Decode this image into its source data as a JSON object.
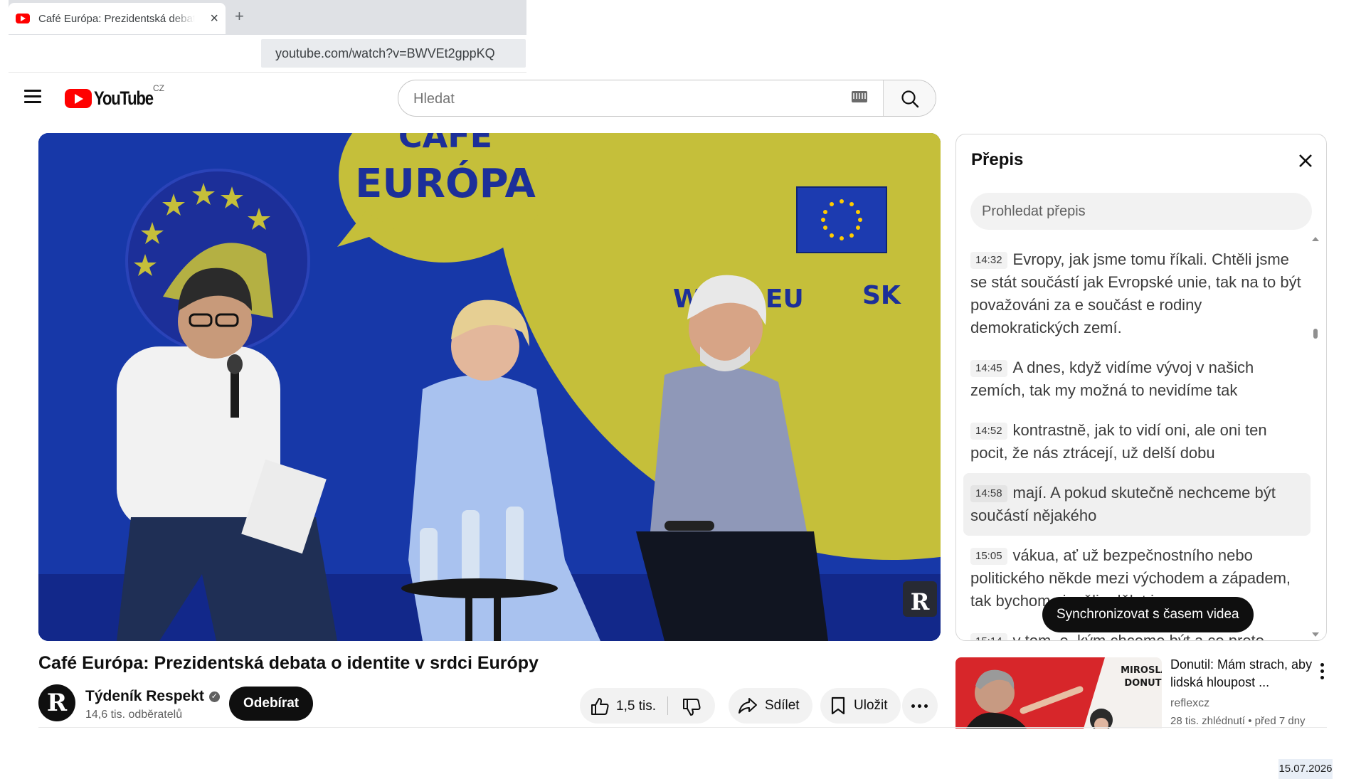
{
  "browser": {
    "tab_title": "Café Európa: Prezidentská debata o identite v srdci Európy - YouTube",
    "new_tab_symbol": "+",
    "close_symbol": "×",
    "address": "youtube.com/watch?v=BWVEt2gppKQ"
  },
  "header": {
    "logo_text": "YouTube",
    "country_code": "CZ",
    "search_placeholder": "Hledat"
  },
  "video": {
    "title": "Café Európa: Prezidentská debata o identite v srdci Európy",
    "frame_text": {
      "bubble_top": "CAFE",
      "bubble_main": "EURÓPA",
      "website_left": "WWW.EU",
      "website_right": "SK",
      "watermark": "R"
    }
  },
  "channel": {
    "avatar_letter": "R",
    "name": "Týdeník Respekt",
    "verified_mark": "✓",
    "subscribers": "14,6 tis. odběratelů",
    "subscribe_label": "Odebírat"
  },
  "actions": {
    "like_count": "1,5 tis.",
    "share_label": "Sdílet",
    "save_label": "Uložit"
  },
  "transcript": {
    "title": "Přepis",
    "search_placeholder": "Prohledat přepis",
    "segments": [
      {
        "time": "14:32",
        "text": "Evropy, jak jsme tomu říkali. Chtěli jsme se stát součástí jak Evropské unie, tak na to být považováni za e součást e rodiny demokratických zemí."
      },
      {
        "time": "14:45",
        "text": "A dnes, když vidíme vývoj v našich zemích, tak my možná to nevidíme tak"
      },
      {
        "time": "14:52",
        "text": "kontrastně, jak to vidí oni, ale oni ten pocit, že nás ztrácejí, už delší dobu"
      },
      {
        "time": "14:58",
        "text": "mají. A pokud skutečně nechceme být součástí nějakého"
      },
      {
        "time": "15:05",
        "text": "vákua, ať už bezpečnostního nebo politického někde mezi východem a západem, tak bychom si měli udělat jasno"
      },
      {
        "time": "15:14",
        "text": "v tom, e, kým chceme být a co proto"
      }
    ],
    "active_index": 3,
    "sync_button": "Synchronizovat s časem videa"
  },
  "recommendation": {
    "thumb_name_line1": "MIROSLAV",
    "thumb_name_line2": "DONUTIL",
    "title": "Donutil: Mám strach, aby lidská hloupost ...",
    "channel": "reflexcz",
    "meta": "28 tis. zhlédnutí • před 7 dny"
  },
  "taskbar": {
    "date": "15.07.2026"
  },
  "colors": {
    "youtube_red": "#ff0000",
    "video_background_blue": "#1738a8",
    "stage_yellow": "#c5bf3a"
  }
}
